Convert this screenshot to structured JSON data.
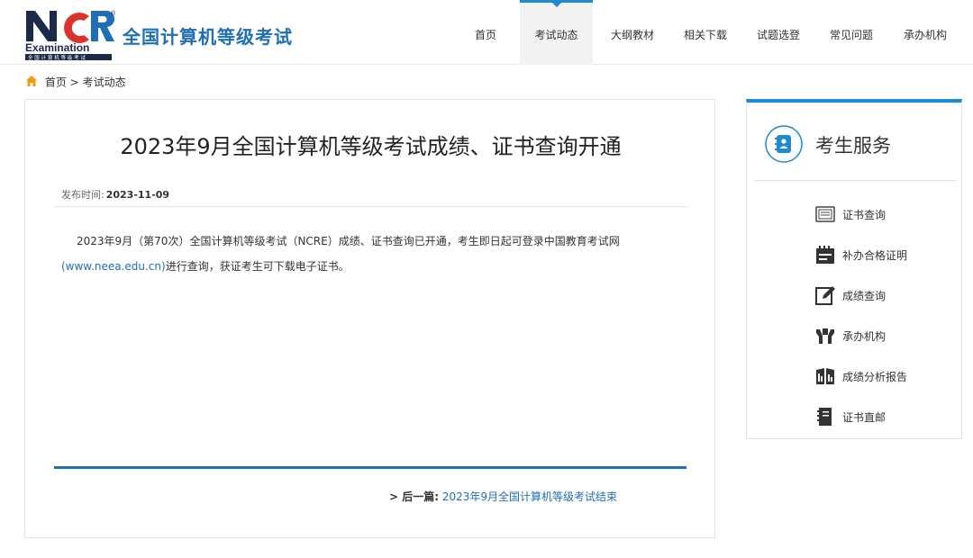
{
  "header": {
    "site_title": "全国计算机等级考试",
    "logo": {
      "mark": "NCR",
      "word": "Examination",
      "sub": "全国计算机等级考试",
      "registered": "®"
    },
    "nav": [
      {
        "label": "首页",
        "active": false
      },
      {
        "label": "考试动态",
        "active": true
      },
      {
        "label": "大纲教材",
        "active": false
      },
      {
        "label": "相关下载",
        "active": false
      },
      {
        "label": "试题选登",
        "active": false
      },
      {
        "label": "常见问题",
        "active": false
      },
      {
        "label": "承办机构",
        "active": false
      }
    ]
  },
  "breadcrumb": {
    "home": "首页",
    "separator": ">",
    "current": "考试动态"
  },
  "article": {
    "title": "2023年9月全国计算机等级考试成绩、证书查询开通",
    "publish_label": "发布时间:",
    "publish_date": "2023-11-09",
    "body_pre": "2023年9月（第70次）全国计算机等级考试（NCRE）成绩、证书查询已开通，考生即日起可登录中国教育考试网",
    "body_link": "(www.neea.edu.cn)",
    "body_post": "进行查询，获证考生可下载电子证书。",
    "next_prefix": "> 后一篇:",
    "next_title": "2023年9月全国计算机等级考试结束"
  },
  "sidebar": {
    "title": "考生服务",
    "items": [
      {
        "label": "证书查询",
        "icon": "certificate-query-icon"
      },
      {
        "label": "补办合格证明",
        "icon": "reissue-certificate-icon"
      },
      {
        "label": "成绩查询",
        "icon": "score-query-icon"
      },
      {
        "label": "承办机构",
        "icon": "organizer-icon"
      },
      {
        "label": "成绩分析报告",
        "icon": "analysis-report-icon"
      },
      {
        "label": "证书直邮",
        "icon": "certificate-mail-icon"
      }
    ]
  },
  "colors": {
    "brand_blue": "#1e6fb5",
    "accent_blue": "#1e8ad2",
    "logo_red": "#d9342b",
    "logo_navy": "#1b2a4a",
    "home_orange": "#f39c12"
  }
}
